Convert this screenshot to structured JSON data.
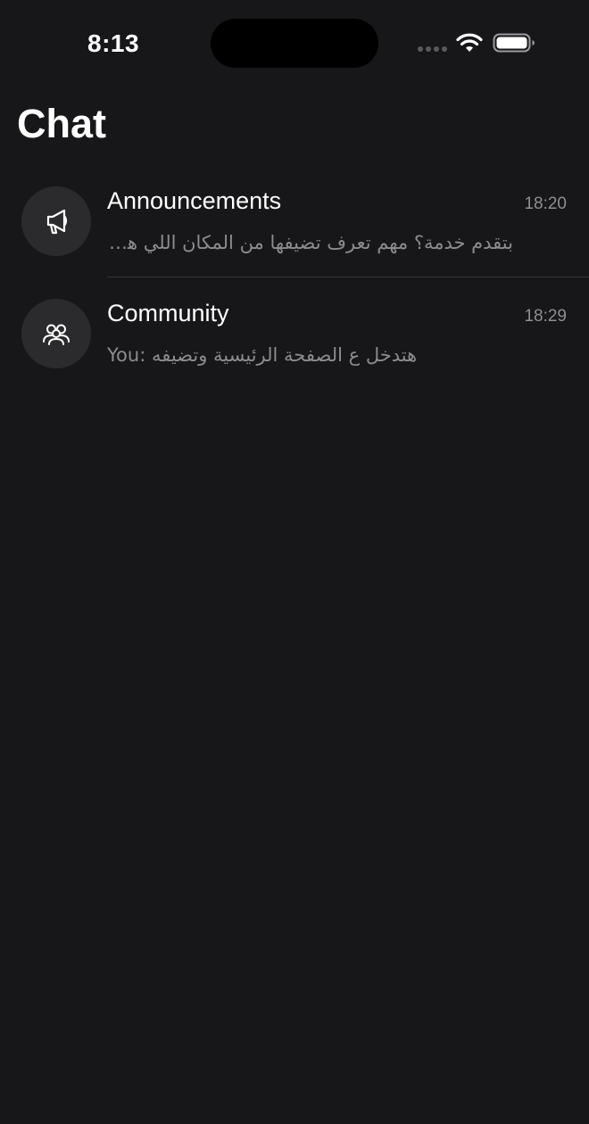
{
  "status_bar": {
    "time": "8:13"
  },
  "header": {
    "title": "Chat"
  },
  "chats": [
    {
      "name": "Announcements",
      "time": "18:20",
      "preview": "بتقدم خدمة؟ مهم تعرف تضيفها من المكان اللي هيظهر فيه",
      "icon": "megaphone-icon"
    },
    {
      "name": "Community",
      "time": "18:29",
      "preview": "You: هتدخل ع الصفحة الرئيسية وتضيفه",
      "icon": "people-group-icon"
    }
  ],
  "colors": {
    "background": "#171719",
    "avatar": "#2b2b2d",
    "secondary_text": "#8e8e93"
  }
}
